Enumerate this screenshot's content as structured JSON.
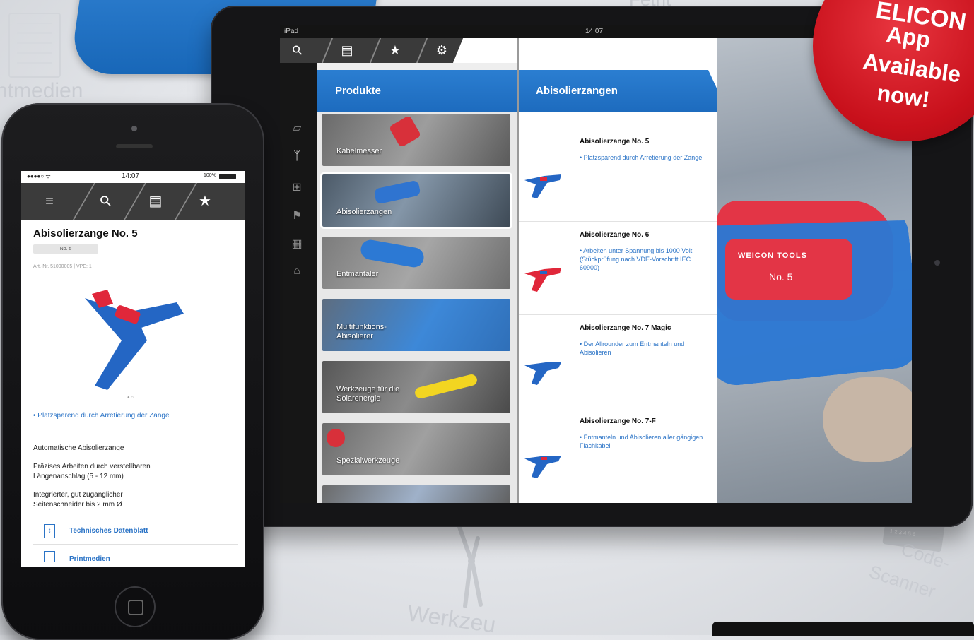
{
  "background_words": {
    "top_left": "ntmedien",
    "top_right": "Fetrit",
    "bottom_center": "Werkzeu",
    "bottom_right_1": "Code-",
    "bottom_right_2": "Scanner",
    "scanner_digits": "123456"
  },
  "badge": {
    "line1": "ELICON",
    "line2": "App",
    "line3": "Available",
    "line4": "now!"
  },
  "tablet": {
    "status": {
      "carrier": "iPad",
      "time": "14:07"
    },
    "toolbar": {
      "search": "⚲",
      "scanner": "▤",
      "favorites": "★",
      "settings": "⚙"
    },
    "left_rail": [
      "▱",
      "ᛉ",
      "⊞",
      "⚑",
      "▦",
      "⌂"
    ],
    "col1": {
      "title": "Produkte",
      "tiles": [
        {
          "label": "Kabelmesser"
        },
        {
          "label": "Abisolierzangen"
        },
        {
          "label": "Entmantaler"
        },
        {
          "label": "Multifunktions-Abisolierer"
        },
        {
          "label": "Werkzeuge für die Solarenergie"
        },
        {
          "label": "Spezialwerkzeuge"
        },
        {
          "label": ""
        }
      ]
    },
    "col2": {
      "title": "Abisolierzangen",
      "items": [
        {
          "title": "Abisolierzange No. 5",
          "bullet": "• Platzsparend durch Arretierung der Zange"
        },
        {
          "title": "Abisolierzange No. 6",
          "bullet": "• Arbeiten unter Spannung bis 1000 Volt (Stückprüfung nach VDE-Vorschrift IEC 60900)"
        },
        {
          "title": "Abisolierzange No. 7 Magic",
          "bullet": "• Der Allrounder zum Entmanteln und Abisolieren"
        },
        {
          "title": "Abisolierzange No. 7-F",
          "bullet": "• Entmanteln und Abisolieren aller gängigen Flachkabel"
        }
      ]
    },
    "photo": {
      "brand": "WEICON TOOLS",
      "model": "No. 5"
    }
  },
  "phone": {
    "status": {
      "signal": "●●●●○ ᯤ",
      "time": "14:07",
      "battery": "100%"
    },
    "toolbar": {
      "menu": "≡",
      "search": "⚲",
      "scanner": "▤",
      "favorites": "★"
    },
    "title": "Abisolierzange No. 5",
    "chip": "No. 5",
    "article": "Art.-Nr. 51000005 | VPE: 1",
    "pager": "● ○",
    "bullet": "• Platzsparend durch Arretierung der Zange",
    "text1": "Automatische Abisolierzange",
    "text2": "Präzises Arbeiten durch verstellbaren Längenanschlag (5 - 12 mm)",
    "text3": "Integrierter, gut zugänglicher Seitenschneider bis 2 mm Ø",
    "link1": "Technisches Datenblatt",
    "link2": "Printmedien"
  },
  "colors": {
    "accent_blue": "#1d6bbe",
    "badge_red": "#c8101b",
    "tool_red": "#e0273a",
    "tool_blue": "#2466c4"
  }
}
